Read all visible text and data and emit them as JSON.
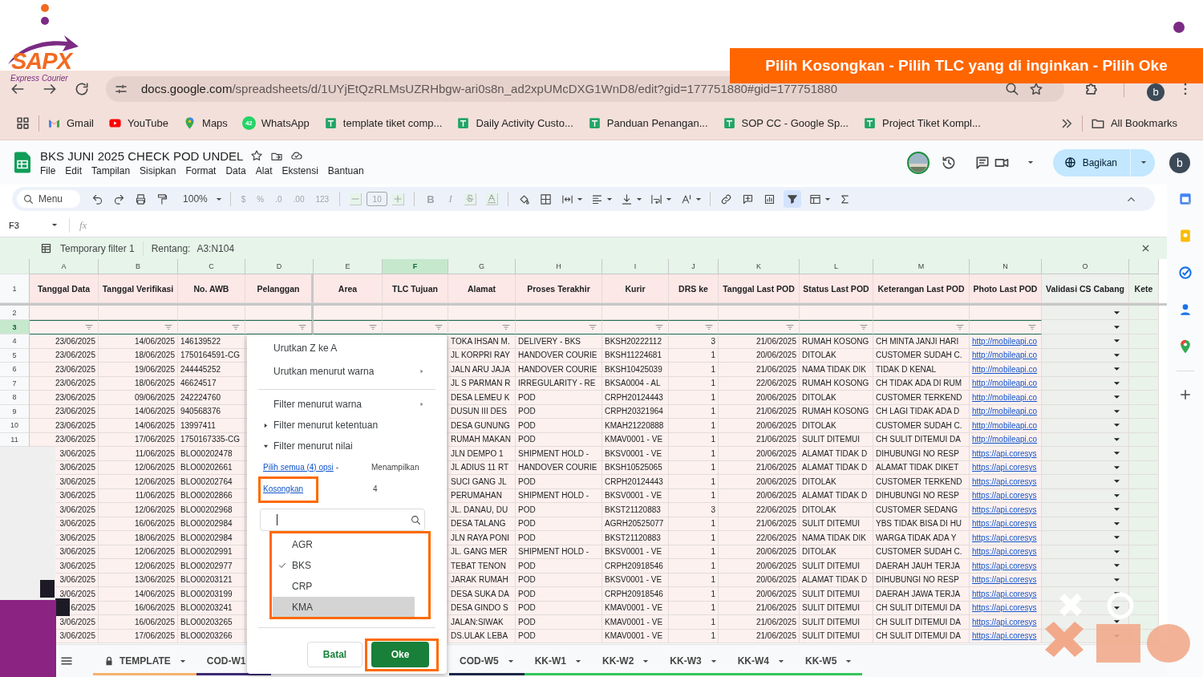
{
  "slide": {
    "logo_brand": "SAPX",
    "logo_tagline": "Express Courier",
    "banner": "Pilih Kosongkan - Pilih TLC yang di inginkan - Pilih Oke"
  },
  "browser": {
    "url_host": "docs.google.com",
    "url_path": "/spreadsheets/d/1UYjEtQzRLMsUZRHbgw-ari0s8n_ad2xpUMcDXG1WnD8/edit?gid=177751880#gid=177751880",
    "profile": "b",
    "bookmarks": [
      {
        "label": "Gmail",
        "kind": "mail"
      },
      {
        "label": "YouTube",
        "kind": "video"
      },
      {
        "label": "Maps",
        "kind": "pin"
      },
      {
        "label": "WhatsApp",
        "kind": "chat",
        "badge": "42"
      },
      {
        "label": "template tiket comp...",
        "kind": "sheet"
      },
      {
        "label": "Daily Activity Custo...",
        "kind": "sheet"
      },
      {
        "label": "Panduan Penangan...",
        "kind": "sheet"
      },
      {
        "label": "SOP CC - Google Sp...",
        "kind": "sheet"
      },
      {
        "label": "Project Tiket Kompl...",
        "kind": "sheet"
      }
    ],
    "all_bookmarks": "All Bookmarks"
  },
  "doc": {
    "title": "BKS JUNI 2025 CHECK POD UNDEL",
    "menu": [
      "File",
      "Edit",
      "Tampilan",
      "Sisipkan",
      "Format",
      "Data",
      "Alat",
      "Ekstensi",
      "Bantuan"
    ],
    "share": "Bagikan",
    "avatar": "b"
  },
  "toolbar": {
    "search": "Menu",
    "zoom": "100%",
    "number_formats": [
      "$",
      "%",
      ".0",
      ".00",
      "123"
    ],
    "font_size": "10",
    "bold": "B",
    "italic": "I",
    "filter_active": true
  },
  "formula_bar": {
    "cell": "F3",
    "fx": "fx"
  },
  "filter_bar": {
    "name": "Temporary filter 1",
    "range_label": "Rentang:",
    "range": "A3:N104"
  },
  "sheet": {
    "columns": [
      {
        "letter": "A",
        "header": "Tanggal Data",
        "kind": "date",
        "selected": false
      },
      {
        "letter": "B",
        "header": "Tanggal Verifikasi",
        "kind": "date",
        "selected": false
      },
      {
        "letter": "C",
        "header": "No. AWB",
        "kind": "text",
        "selected": false
      },
      {
        "letter": "D",
        "header": "Pelanggan",
        "kind": "text",
        "selected": false
      },
      {
        "letter": "E",
        "header": "Area",
        "kind": "text",
        "selected": false
      },
      {
        "letter": "F",
        "header": "TLC Tujuan",
        "kind": "text",
        "selected": true
      },
      {
        "letter": "G",
        "header": "Alamat",
        "kind": "text",
        "selected": false
      },
      {
        "letter": "H",
        "header": "Proses Terakhir",
        "kind": "text",
        "selected": false
      },
      {
        "letter": "I",
        "header": "Kurir",
        "kind": "text",
        "selected": false
      },
      {
        "letter": "J",
        "header": "DRS ke",
        "kind": "number",
        "selected": false
      },
      {
        "letter": "K",
        "header": "Tanggal Last POD",
        "kind": "date",
        "selected": false
      },
      {
        "letter": "L",
        "header": "Status Last POD",
        "kind": "text",
        "selected": false
      },
      {
        "letter": "M",
        "header": "Keterangan Last POD",
        "kind": "text",
        "selected": false
      },
      {
        "letter": "N",
        "header": "Photo Last POD",
        "kind": "link",
        "selected": false
      },
      {
        "letter": "O",
        "header": "Validasi CS Cabang",
        "kind": "dropdown",
        "selected": false
      },
      {
        "header": "Kete",
        "kind": "blank",
        "selected": false
      }
    ],
    "header_row": "1",
    "blank_row": "2",
    "filter_row": {
      "num": "3",
      "selected": true
    },
    "rows": [
      {
        "num": "4",
        "cells": [
          "23/06/2025",
          "14/06/2025",
          "146139522",
          "",
          "",
          "",
          "TOKA IHSAN M.",
          "DELIVERY  - BKS",
          "BKSH20222112",
          "3",
          "21/06/2025",
          "RUMAH KOSONG",
          "CH MINTA JANJI HARI",
          "http://mobileapi.co"
        ]
      },
      {
        "num": "5",
        "cells": [
          "23/06/2025",
          "18/06/2025",
          "1750164591-CG",
          "",
          "",
          "",
          "JL KORPRI RAY",
          "HANDOVER COURIE",
          "BKSH11224681",
          "1",
          "20/06/2025",
          "DITOLAK",
          "CUSTOMER SUDAH C.",
          "http://mobileapi.co"
        ]
      },
      {
        "num": "6",
        "cells": [
          "23/06/2025",
          "19/06/2025",
          "244445252",
          "",
          "",
          "",
          "JALN ARU JAJA",
          "HANDOVER COURIE",
          "BKSH10425039",
          "1",
          "21/06/2025",
          "NAMA TIDAK DIK",
          "TIDAK D KENAL",
          "http://mobileapi.co"
        ]
      },
      {
        "num": "7",
        "cells": [
          "23/06/2025",
          "18/06/2025",
          "46624517",
          "",
          "",
          "",
          "JL S PARMAN R",
          "IRREGULARITY - RE",
          "BKSA0004 - AL",
          "1",
          "22/06/2025",
          "RUMAH KOSONG",
          "CH TIDAK ADA DI RUM",
          "http://mobileapi.co"
        ]
      },
      {
        "num": "8",
        "cells": [
          "23/06/2025",
          "09/06/2025",
          "242224760",
          "",
          "",
          "",
          "DESA LEMEU K",
          "POD",
          "CRPH20124443",
          "1",
          "20/06/2025",
          "DITOLAK",
          "CUSTOMER TERKEND",
          "http://mobileapi.co"
        ]
      },
      {
        "num": "9",
        "cells": [
          "23/06/2025",
          "14/06/2025",
          "940568376",
          "",
          "",
          "",
          "DUSUN III DES",
          "POD",
          "CRPH20321964",
          "1",
          "21/06/2025",
          "RUMAH KOSONG",
          "CH LAGI TIDAK ADA D",
          "http://mobileapi.co"
        ]
      },
      {
        "num": "10",
        "cells": [
          "23/06/2025",
          "14/06/2025",
          "13997411",
          "",
          "",
          "",
          "DESA GUNUNG",
          "POD",
          "KMAH21220888",
          "1",
          "20/06/2025",
          "DITOLAK",
          "CUSTOMER SUDAH C.",
          "http://mobileapi.co"
        ]
      },
      {
        "num": "11",
        "cells": [
          "23/06/2025",
          "17/06/2025",
          "1750167335-CG",
          "",
          "",
          "",
          "RUMAH MAKAN",
          "POD",
          "KMAV0001 - VE",
          "1",
          "21/06/2025",
          "SULIT DITEMUI",
          "CH SULIT DITEMUI DA",
          "http://mobileapi.co"
        ]
      },
      {
        "cells": [
          "3/06/2025",
          "11/06/2025",
          "BLO00202478",
          "",
          "",
          "",
          "JLN DEMPO 1",
          "SHIPMENT HOLD -",
          "BKSV0001 - VE",
          "1",
          "20/06/2025",
          "ALAMAT TIDAK D",
          "DIHUBUNGI NO RESP",
          "https://api.coresys"
        ]
      },
      {
        "cells": [
          "3/06/2025",
          "12/06/2025",
          "BLO00202661",
          "",
          "",
          "",
          "JL ADIUS 11 RT",
          "HANDOVER COURIE",
          "BKSH10525065",
          "1",
          "21/06/2025",
          "ALAMAT TIDAK D",
          "ALAMAT TIDAK DIKET",
          "https://api.coresys"
        ]
      },
      {
        "cells": [
          "3/06/2025",
          "12/06/2025",
          "BLO00202764",
          "",
          "",
          "",
          "SUCI GANG JL",
          "POD",
          "CRPH20124443",
          "1",
          "20/06/2025",
          "DITOLAK",
          "CUSTOMER TERKEND",
          "https://api.coresys"
        ]
      },
      {
        "cells": [
          "3/06/2025",
          "11/06/2025",
          "BLO00202866",
          "",
          "",
          "",
          "PERUMAHAN",
          "SHIPMENT HOLD -",
          "BKSV0001 - VE",
          "1",
          "20/06/2025",
          "ALAMAT TIDAK D",
          "DIHUBUNGI NO RESP",
          "https://api.coresys"
        ]
      },
      {
        "cells": [
          "3/06/2025",
          "12/06/2025",
          "BLO00202968",
          "",
          "",
          "",
          "JL. DANAU, DU",
          "POD",
          "BKST21120883",
          "3",
          "22/06/2025",
          "DITOLAK",
          "CUSTOMER SEDANG",
          "https://api.coresys"
        ]
      },
      {
        "cells": [
          "3/06/2025",
          "16/06/2025",
          "BLO00202984",
          "",
          "",
          "",
          "DESA TALANG",
          "POD",
          "AGRH20525077",
          "1",
          "21/06/2025",
          "SULIT DITEMUI",
          "YBS TIDAK BISA DI HU",
          "https://api.coresys"
        ]
      },
      {
        "cells": [
          "3/06/2025",
          "18/06/2025",
          "BLO00202984",
          "",
          "",
          "",
          "JLN RAYA PONI",
          "POD",
          "BKST21120883",
          "1",
          "22/06/2025",
          "NAMA TIDAK DIK",
          "WARGA TIDAK ADA Y",
          "https://api.coresys"
        ]
      },
      {
        "cells": [
          "3/06/2025",
          "12/06/2025",
          "BLO00202991",
          "",
          "",
          "",
          "JL. GANG MER",
          "SHIPMENT HOLD -",
          "BKSV0001 - VE",
          "1",
          "20/06/2025",
          "DITOLAK",
          "CUSTOMER SUDAH C.",
          "https://api.coresys"
        ]
      },
      {
        "cells": [
          "3/06/2025",
          "12/06/2025",
          "BLO00202977",
          "",
          "",
          "",
          "TEBAT TENON",
          "POD",
          "CRPH20918546",
          "1",
          "20/06/2025",
          "SULIT DITEMUI",
          "DAERAH JAUH TERJA",
          "https://api.coresys"
        ]
      },
      {
        "cells": [
          "3/06/2025",
          "13/06/2025",
          "BLO00203121",
          "",
          "",
          "",
          "JARAK RUMAH",
          "POD",
          "BKSV0001 - VE",
          "1",
          "20/06/2025",
          "ALAMAT TIDAK D",
          "DIHUBUNGI NO RESP",
          "https://api.coresys"
        ]
      },
      {
        "cells": [
          "3/06/2025",
          "14/06/2025",
          "BLO00203199",
          "",
          "",
          "",
          "DESA SUKA DA",
          "POD",
          "CRPH20918546",
          "1",
          "20/06/2025",
          "SULIT DITEMUI",
          "DAERAH JAWA TERJA",
          "https://api.coresys"
        ]
      },
      {
        "cells": [
          "6/2025",
          "16/06/2025",
          "BLO00203241",
          "",
          "",
          "",
          "DESA GINDO S",
          "POD",
          "KMAV0001 - VE",
          "1",
          "21/06/2025",
          "SULIT DITEMUI",
          "CH SULIT DITEMUI DA",
          "https://api.coresys"
        ]
      },
      {
        "cells": [
          "3/06/2025",
          "16/06/2025",
          "BLO00203265",
          "",
          "",
          "",
          "JALAN:SIWAK",
          "POD",
          "KMAV0001 - VE",
          "1",
          "21/06/2025",
          "SULIT DITEMUI",
          "CH SULIT DITEMUI DA",
          "https://api.coresys"
        ]
      },
      {
        "cells": [
          "3/06/2025",
          "17/06/2025",
          "BLO00203266",
          "",
          "",
          "",
          "DS.ULAK LEBA",
          "POD",
          "KMAV0001 - VE",
          "1",
          "21/06/2025",
          "SULIT DITEMUI",
          "CH SULIT DITEMUI DA",
          "https://api.coresys"
        ]
      }
    ]
  },
  "filter_menu": {
    "sort": [
      {
        "label": "Urutkan Z ke A",
        "submenu": false
      },
      {
        "label": "Urutkan menurut warna",
        "submenu": true
      }
    ],
    "filters": [
      {
        "label": "Filter menurut warna",
        "kind": "submenu"
      },
      {
        "label": "Filter menurut ketentuan",
        "kind": "collapsed"
      },
      {
        "label": "Filter menurut nilai",
        "kind": "expanded"
      }
    ],
    "select_all": "Pilih semua (4) opsi",
    "select_all_sep": "-",
    "showing_label": "Menampilkan",
    "clear": {
      "label": "Kosongkan",
      "highlight": true
    },
    "showing_count": "4",
    "values": {
      "highlight": true,
      "items": [
        {
          "label": "AGR",
          "checked": false,
          "hovered": false
        },
        {
          "label": "BKS",
          "checked": true,
          "hovered": false
        },
        {
          "label": "CRP",
          "checked": false,
          "hovered": false
        },
        {
          "label": "KMA",
          "checked": false,
          "hovered": true
        }
      ]
    },
    "cancel": "Batal",
    "ok": {
      "label": "Oke",
      "highlight": true
    }
  },
  "sheet_tabs": [
    {
      "label": "TEMPLATE",
      "locked": true,
      "color": "#f6b26b"
    },
    {
      "label": "COD-W1",
      "locked": false,
      "color": "#3d2a73"
    },
    {
      "label": "COD-W5",
      "locked": false,
      "color": "#1c2847"
    },
    {
      "label": "KK-W1",
      "locked": false,
      "color": "#34c759"
    },
    {
      "label": "KK-W2",
      "locked": false,
      "color": "#34c759"
    },
    {
      "label": "KK-W3",
      "locked": false,
      "color": "#34c759"
    },
    {
      "label": "KK-W4",
      "locked": false,
      "color": "#34c759"
    },
    {
      "label": "KK-W5",
      "locked": false,
      "color": "#34c759"
    }
  ]
}
